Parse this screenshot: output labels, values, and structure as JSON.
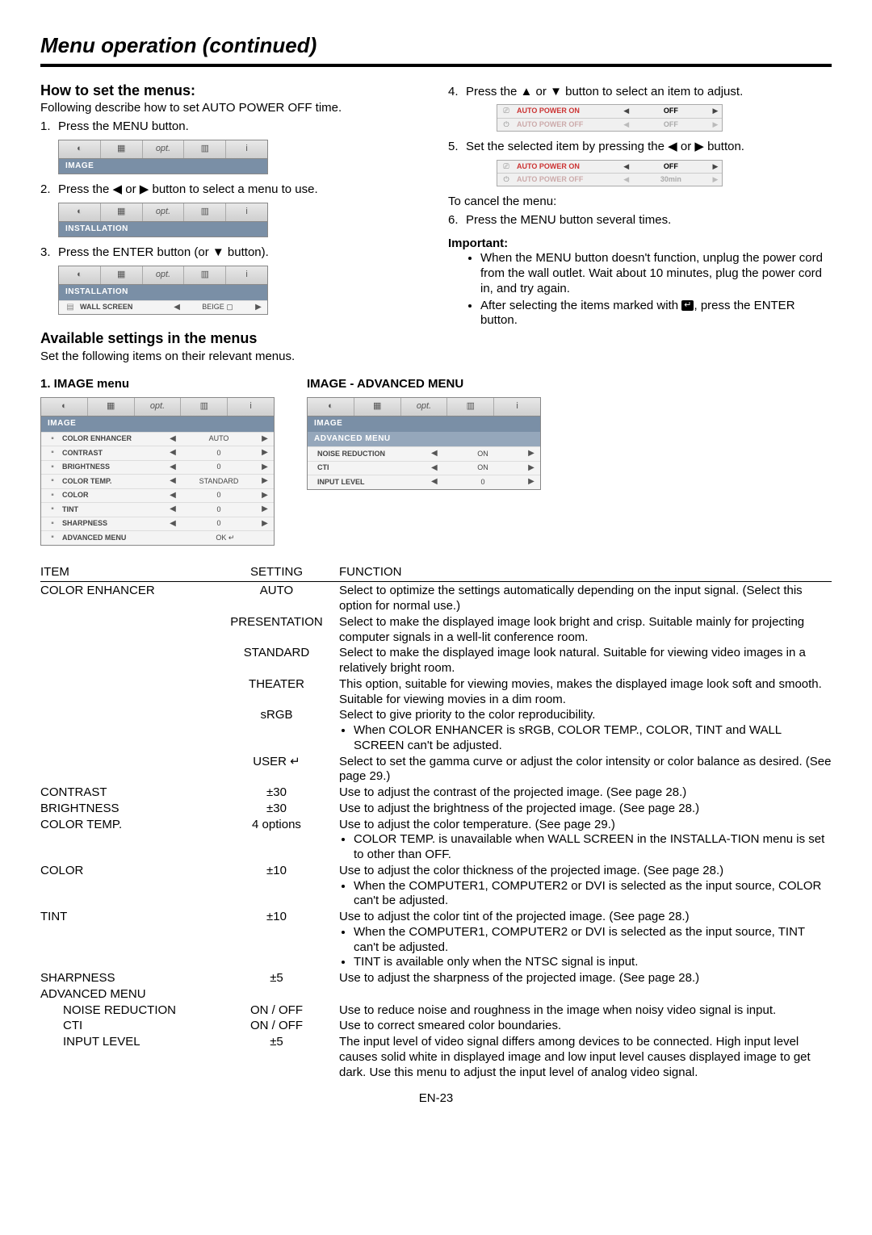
{
  "page_title": "Menu operation (continued)",
  "page_number": "EN-23",
  "left": {
    "h_howto": "How to set the menus:",
    "intro": "Following describe how to set AUTO POWER OFF time.",
    "s1": "Press the MENU button.",
    "s2_a": "Press the ",
    "s2_b": " or ",
    "s2_c": " button to select a menu to use.",
    "s3_a": "Press the ENTER button (or ",
    "s3_b": " button).",
    "h_avail": "Available settings in the menus",
    "avail_intro": "Set the following items on their relevant menus.",
    "image_menu_head": "1. IMAGE menu",
    "adv_menu_head": "IMAGE - ADVANCED MENU"
  },
  "right": {
    "s4_a": "Press the ",
    "s4_b": " or ",
    "s4_c": " button to select an item to adjust.",
    "s5_a": "Set the selected item by pressing the ",
    "s5_b": " or ",
    "s5_c": " button.",
    "cancel": "To cancel the menu:",
    "s6": "Press the MENU button several times.",
    "important_h": "Important:",
    "imp1": "When the MENU button doesn't function, unplug the power cord from the wall outlet. Wait about 10 minutes, plug the power cord in, and try again.",
    "imp2_a": "After selecting the items marked with ",
    "imp2_b": ", press the ENTER button."
  },
  "menu_strip": {
    "opt_label": "opt.",
    "info_glyph": "i",
    "title_image": "IMAGE",
    "title_install": "INSTALLATION",
    "title_adv": "ADVANCED MENU",
    "wall_screen": "WALL SCREEN",
    "beige": "BEIGE"
  },
  "image_rows": [
    {
      "label": "COLOR ENHANCER",
      "value": "AUTO"
    },
    {
      "label": "CONTRAST",
      "value": "0"
    },
    {
      "label": "BRIGHTNESS",
      "value": "0"
    },
    {
      "label": "COLOR TEMP.",
      "value": "STANDARD"
    },
    {
      "label": "COLOR",
      "value": "0"
    },
    {
      "label": "TINT",
      "value": "0"
    },
    {
      "label": "SHARPNESS",
      "value": "0"
    },
    {
      "label": "ADVANCED MENU",
      "value": "OK ↵"
    }
  ],
  "adv_rows": [
    {
      "label": "NOISE REDUCTION",
      "value": "ON"
    },
    {
      "label": "CTI",
      "value": "ON"
    },
    {
      "label": "INPUT LEVEL",
      "value": "0"
    }
  ],
  "ap": {
    "on_label": "AUTO POWER ON",
    "off_label": "AUTO POWER OFF",
    "off_val": "OFF",
    "t30": "30min"
  },
  "table": {
    "h_item": "ITEM",
    "h_setting": "SETTING",
    "h_function": "FUNCTION",
    "rows": [
      {
        "item": "COLOR ENHANCER",
        "setting": "AUTO",
        "fn": "Select to optimize the settings automatically depending on the input signal. (Select this option for normal use.)"
      },
      {
        "item": "",
        "setting": "PRESENTATION",
        "fn": "Select to make the displayed image look bright and crisp. Suitable mainly for projecting computer signals in a well-lit conference room."
      },
      {
        "item": "",
        "setting": "STANDARD",
        "fn": "Select to make the displayed image look natural. Suitable for viewing video images in a relatively bright room."
      },
      {
        "item": "",
        "setting": "THEATER",
        "fn": "This option, suitable for viewing movies, makes the displayed image look soft and smooth. Suitable for viewing movies in a dim room."
      },
      {
        "item": "",
        "setting": "sRGB",
        "fn": "Select to give priority to the color reproducibility.",
        "bul": [
          "When COLOR ENHANCER is sRGB, COLOR TEMP., COLOR, TINT and WALL SCREEN can't be adjusted."
        ]
      },
      {
        "item": "",
        "setting": "USER ↵",
        "fn": "Select to set the gamma curve or adjust the color intensity or color balance as desired. (See page 29.)"
      },
      {
        "item": "CONTRAST",
        "setting": "±30",
        "fn": "Use to adjust the contrast of the projected image. (See page 28.)"
      },
      {
        "item": "BRIGHTNESS",
        "setting": "±30",
        "fn": "Use to adjust the brightness of the projected image. (See page 28.)"
      },
      {
        "item": "COLOR TEMP.",
        "setting": "4 options",
        "fn": "Use to adjust the color temperature. (See page 29.)",
        "bul": [
          "COLOR TEMP. is unavailable when WALL SCREEN in the INSTALLA-TION menu is set to other than OFF."
        ]
      },
      {
        "item": "COLOR",
        "setting": "±10",
        "fn": "Use to adjust the color thickness of the projected image. (See page 28.)",
        "bul": [
          "When the COMPUTER1, COMPUTER2 or DVI is selected as the input source, COLOR can't be adjusted."
        ]
      },
      {
        "item": "TINT",
        "setting": "±10",
        "fn": "Use to adjust the color tint of the projected image. (See page 28.)",
        "bul": [
          "When the COMPUTER1, COMPUTER2 or DVI is selected as the input source, TINT can't be adjusted.",
          "TINT is available only when the NTSC signal is input."
        ]
      },
      {
        "item": "SHARPNESS",
        "setting": "±5",
        "fn": "Use to adjust the sharpness of the projected image. (See page 28.)"
      },
      {
        "item": "ADVANCED MENU",
        "setting": "",
        "fn": ""
      },
      {
        "item": "NOISE REDUCTION",
        "indent": true,
        "setting": "ON / OFF",
        "fn": "Use to reduce noise and roughness in the image when noisy video signal is input."
      },
      {
        "item": "CTI",
        "indent": true,
        "setting": "ON / OFF",
        "fn": "Use to correct smeared color boundaries."
      },
      {
        "item": "INPUT LEVEL",
        "indent": true,
        "setting": "±5",
        "fn": "The input level of video signal differs among devices to be connected. High input level causes solid white in displayed image and low input level causes displayed image to get dark. Use this menu to adjust the input level of analog video signal."
      }
    ]
  }
}
